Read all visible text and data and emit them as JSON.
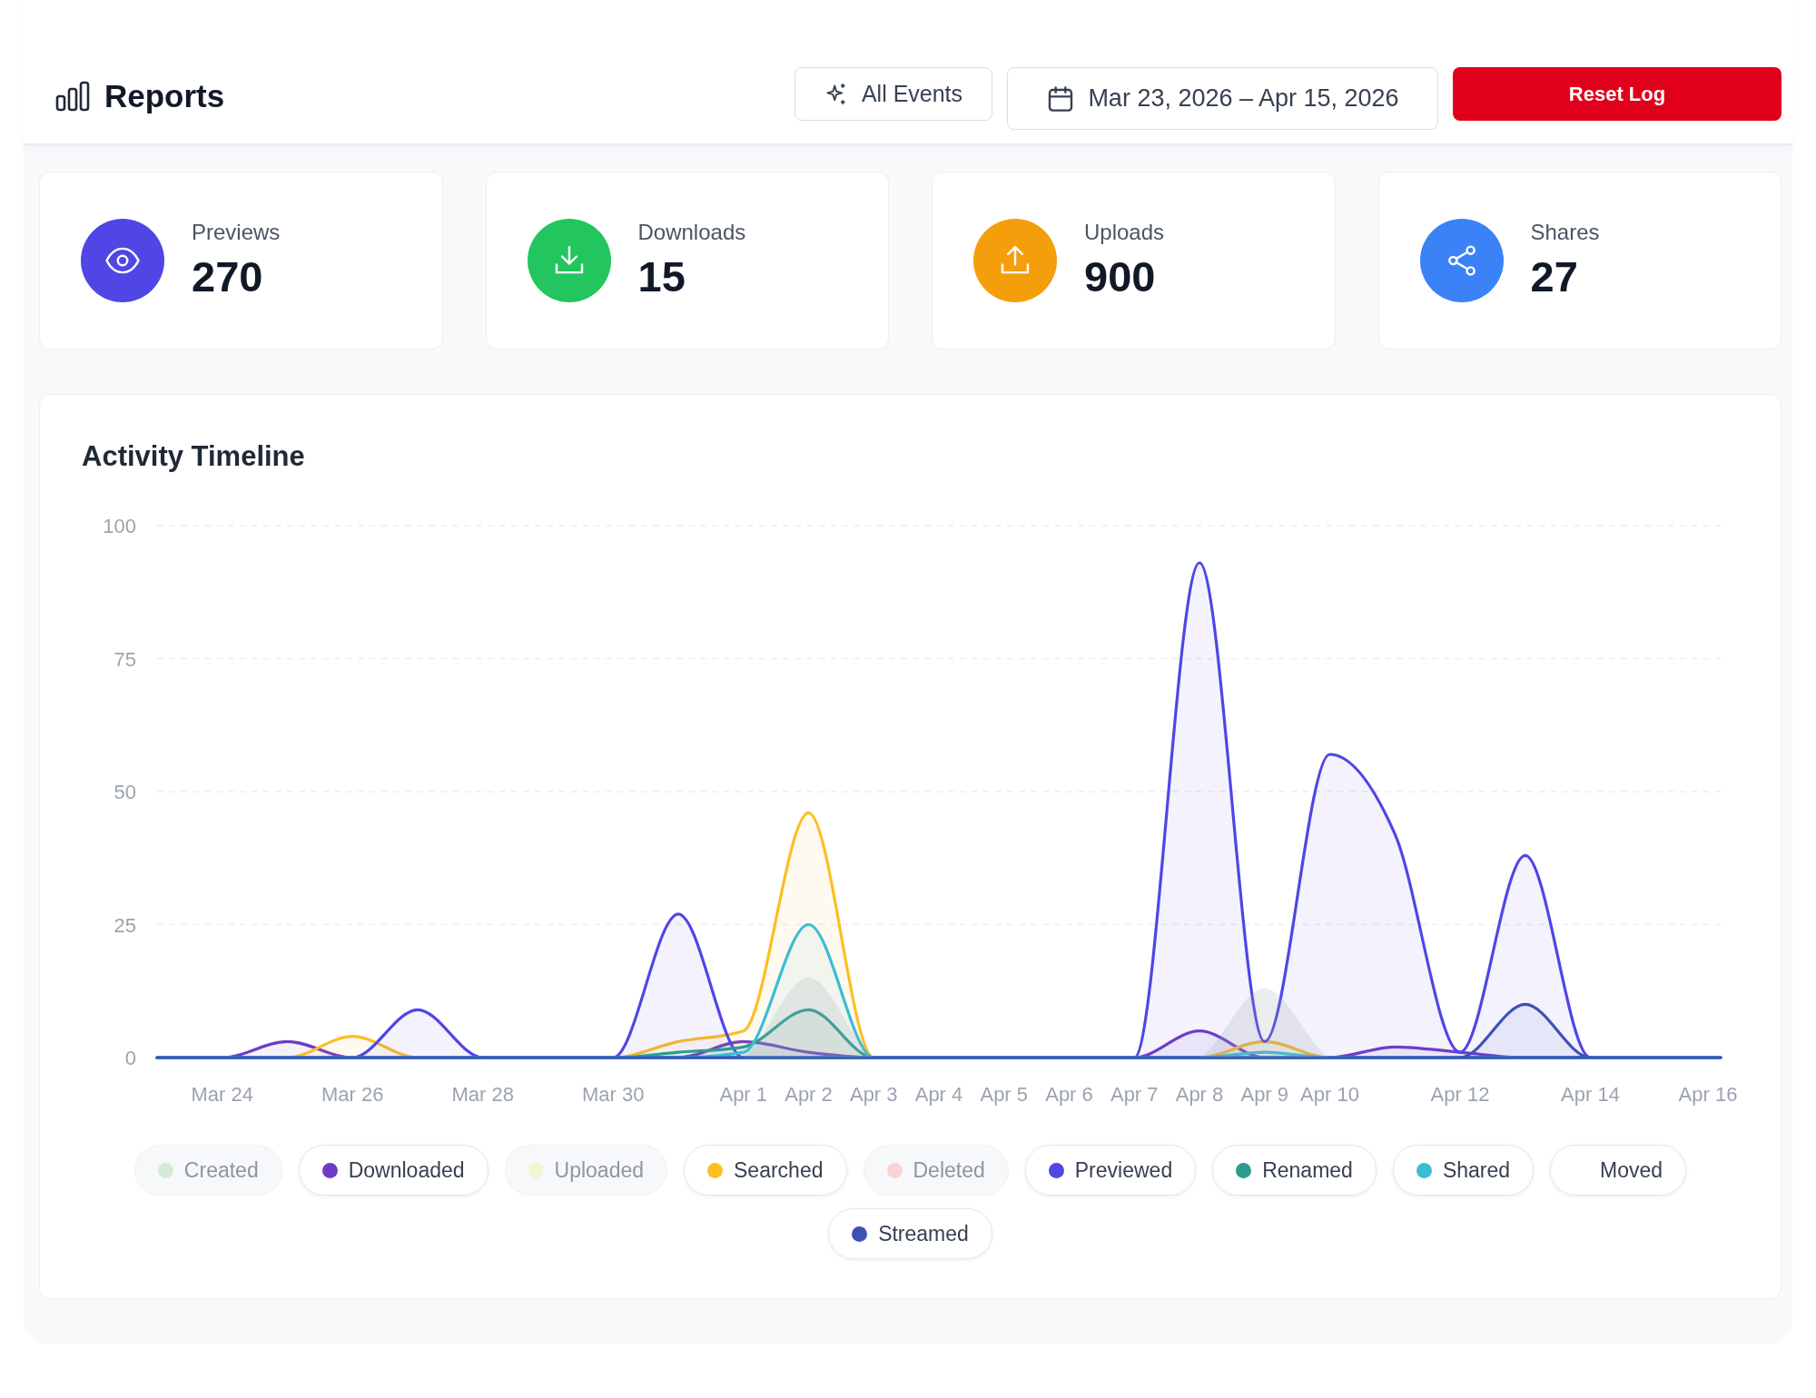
{
  "header": {
    "title": "Reports",
    "filter_button": "All Events",
    "date_range": "Mar 23, 2026 – Apr 15, 2026",
    "reset_button": "Reset Log"
  },
  "stats": [
    {
      "kind": "preview",
      "label": "Previews",
      "value": "270",
      "color": "#4f46e5"
    },
    {
      "kind": "download",
      "label": "Downloads",
      "value": "15",
      "color": "#22c55e"
    },
    {
      "kind": "upload",
      "label": "Uploads",
      "value": "900",
      "color": "#f59e0b"
    },
    {
      "kind": "share",
      "label": "Shares",
      "value": "27",
      "color": "#3b82f6"
    }
  ],
  "timeline": {
    "title": "Activity Timeline",
    "chart_data": {
      "type": "area",
      "stacked": false,
      "grid": true,
      "categories": [
        null,
        "Mar 24",
        null,
        "Mar 26",
        null,
        "Mar 28",
        null,
        "Mar 30",
        null,
        "Apr 1",
        "Apr 2",
        "Apr 3",
        "Apr 4",
        "Apr 5",
        "Apr 6",
        "Apr 7",
        "Apr 8",
        "Apr 9",
        "Apr 10",
        null,
        "Apr 12",
        null,
        "Apr 14",
        null,
        "Apr 16"
      ],
      "ylim": [
        0,
        100
      ],
      "yticks": [
        0,
        25,
        50,
        75,
        100
      ],
      "series": [
        {
          "color": "#6e3cc8",
          "values": [
            0,
            0,
            3,
            0,
            0,
            0,
            0,
            0,
            0,
            3,
            1,
            0,
            0,
            0,
            0,
            0,
            5,
            0,
            0,
            2,
            1,
            0,
            0,
            0,
            0
          ]
        },
        {
          "color": "#fbbf24",
          "values": [
            0,
            0,
            0,
            4,
            0,
            0,
            0,
            0,
            3,
            5,
            46,
            0,
            0,
            0,
            0,
            0,
            0,
            3,
            0,
            0,
            0,
            0,
            0,
            0,
            0
          ]
        },
        {
          "color": "#4f46e5",
          "values": [
            0,
            0,
            0,
            0,
            9,
            0,
            0,
            0,
            27,
            0,
            0,
            0,
            0,
            0,
            0,
            0,
            93,
            3,
            57,
            42,
            1,
            38,
            0,
            0,
            0
          ]
        },
        {
          "color": "#2a9d8f",
          "values": [
            0,
            0,
            0,
            0,
            0,
            0,
            0,
            0,
            1,
            2,
            9,
            0,
            0,
            0,
            0,
            0,
            0,
            0,
            0,
            0,
            0,
            0,
            0,
            0,
            0
          ]
        },
        {
          "color": "#3bbcd4",
          "values": [
            0,
            0,
            0,
            0,
            0,
            0,
            0,
            0,
            0,
            1,
            25,
            0,
            0,
            0,
            0,
            0,
            0,
            1,
            0,
            0,
            0,
            0,
            0,
            0,
            0
          ]
        },
        {
          "color": "#3f51b5",
          "values": [
            0,
            0,
            0,
            0,
            0,
            0,
            0,
            0,
            0,
            0,
            0,
            0,
            0,
            0,
            0,
            0,
            0,
            0,
            0,
            0,
            0,
            10,
            0,
            0,
            0
          ]
        },
        {
          "values": [
            null,
            null,
            null,
            null,
            null,
            null,
            null,
            null,
            null,
            0,
            15,
            0,
            null,
            null,
            null,
            null,
            0,
            13,
            0,
            null,
            null,
            null,
            null,
            null,
            null
          ]
        }
      ]
    },
    "legend": [
      {
        "label": "Created",
        "color": "#d3ebd7",
        "selected": false
      },
      {
        "label": "Downloaded",
        "color": "#6e3cc8",
        "selected": true
      },
      {
        "label": "Uploaded",
        "color": "#eef6d2",
        "selected": false
      },
      {
        "label": "Searched",
        "color": "#fbbf24",
        "selected": true
      },
      {
        "label": "Deleted",
        "color": "#f9d3d3",
        "selected": false
      },
      {
        "label": "Previewed",
        "color": "#4f46e5",
        "selected": true
      },
      {
        "label": "Renamed",
        "color": "#2a9d8f",
        "selected": true
      },
      {
        "label": "Shared",
        "color": "#3bbcd4",
        "selected": true
      },
      {
        "label": "Moved",
        "selected": true
      },
      {
        "label": "Streamed",
        "color": "#3f51b5",
        "selected": true
      }
    ]
  }
}
